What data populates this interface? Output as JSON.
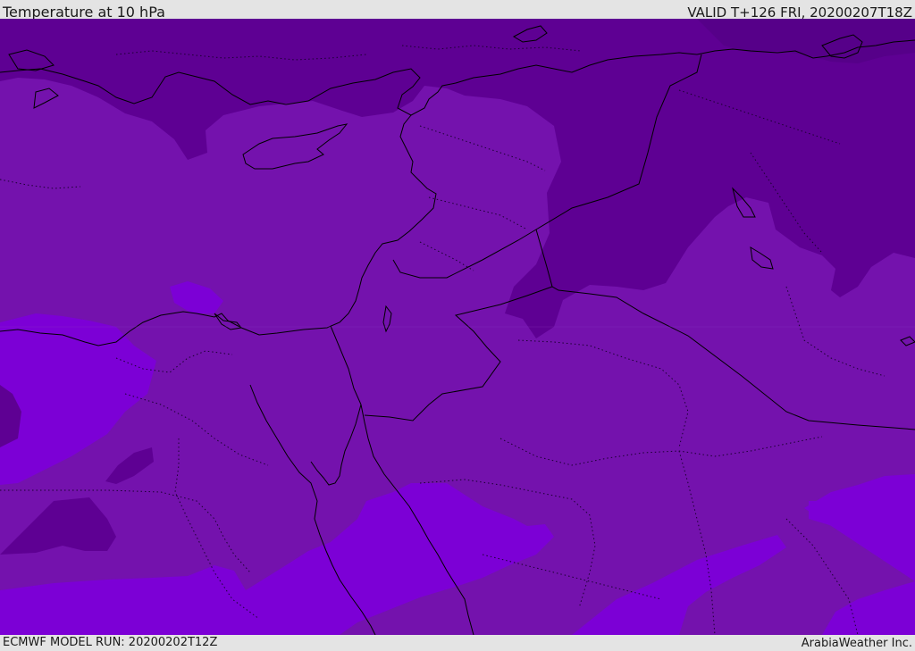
{
  "header": {
    "title": "Temperature at 10 hPa",
    "valid_time": "VALID T+126 FRI, 20200207T18Z"
  },
  "footer": {
    "model_run": "ECMWF MODEL RUN: 20200202T12Z",
    "credit": "ArabiaWeather Inc."
  },
  "map": {
    "variable": "temperature",
    "level": "10 hPa",
    "region": "Eastern Mediterranean / Middle East",
    "colors": {
      "cold_band": "#5e0093",
      "mid_band": "#7412ad",
      "warm_band": "#7c00d6",
      "coastline": "#000000",
      "borders": "#000000"
    }
  }
}
